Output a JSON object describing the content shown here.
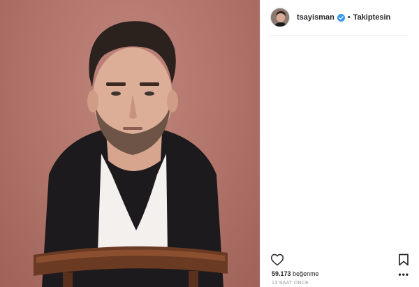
{
  "post": {
    "username": "tsayisman",
    "dot": "•",
    "follow_status": "Takiptesin",
    "likes_count": "59.173",
    "likes_label": "beğenme",
    "timestamp": "13 SAAT ÖNCE",
    "more_label": "•••"
  },
  "colors": {
    "background": "#b07369",
    "verified": "#3897f0",
    "text": "#262626",
    "muted": "#999999"
  },
  "icons": {
    "like": "heart-outline-icon",
    "save": "bookmark-outline-icon",
    "verified": "verified-badge-icon",
    "more": "more-options-icon"
  }
}
